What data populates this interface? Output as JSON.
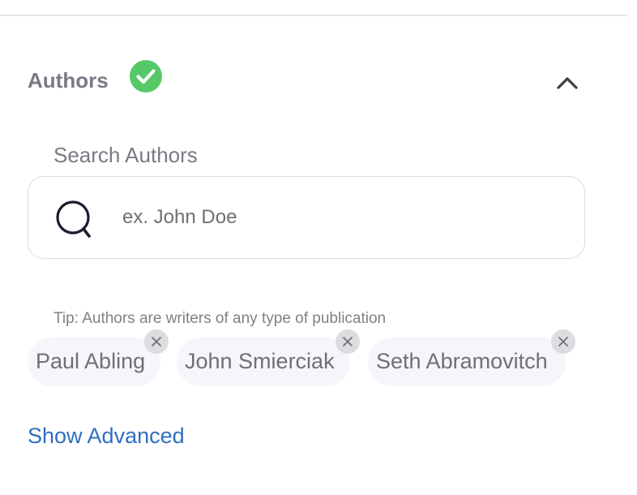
{
  "section": {
    "title": "Authors",
    "status_icon": "check-circle-icon",
    "toggle_icon": "chevron-up-icon"
  },
  "search": {
    "label": "Search Authors",
    "placeholder": "ex. John Doe",
    "value": "",
    "icon": "search-icon"
  },
  "tip": "Tip: Authors are writers of any type of publication",
  "chips": [
    {
      "label": "Paul Abling",
      "remove_icon": "close-icon"
    },
    {
      "label": "John Smierciak",
      "remove_icon": "close-icon"
    },
    {
      "label": "Seth Abramovitch",
      "remove_icon": "close-icon"
    }
  ],
  "advanced": {
    "label": "Show Advanced"
  },
  "colors": {
    "check_green": "#56c868",
    "link_blue": "#2f6fbf",
    "muted_text": "#7a7a86",
    "chip_bg": "#f4f6fc",
    "chip_remove_bg": "#dcdde0",
    "input_border": "#d9dbe6"
  }
}
